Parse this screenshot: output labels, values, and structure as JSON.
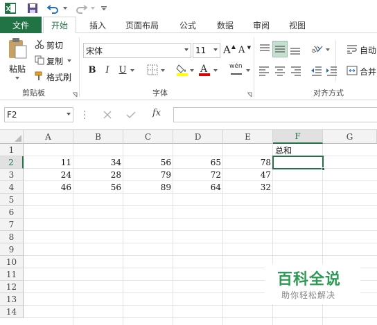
{
  "qat": {
    "icons": [
      "excel-logo-icon",
      "save-icon",
      "undo-icon",
      "redo-icon",
      "customize-icon"
    ]
  },
  "tabs": {
    "file": "文件",
    "items": [
      "开始",
      "插入",
      "页面布局",
      "公式",
      "数据",
      "审阅",
      "视图"
    ],
    "active": "开始"
  },
  "ribbon": {
    "clipboard": {
      "paste": "粘贴",
      "cut": "剪切",
      "copy": "复制",
      "format_painter": "格式刷",
      "group_label": "剪贴板"
    },
    "font": {
      "font_name": "宋体",
      "font_size": "11",
      "bold": "B",
      "italic": "I",
      "underline": "U",
      "increase": "A",
      "decrease": "A",
      "phonetic": "wén",
      "group_label": "字体"
    },
    "alignment": {
      "wrap": "自动",
      "merge": "合并",
      "group_label": "对齐方式"
    }
  },
  "formula_bar": {
    "name_box": "F2",
    "fx": "fx",
    "value": ""
  },
  "grid": {
    "columns": [
      "A",
      "B",
      "C",
      "D",
      "E",
      "F",
      "G"
    ],
    "rows": [
      "1",
      "2",
      "3",
      "4",
      "5",
      "6",
      "7",
      "8",
      "9",
      "10",
      "11",
      "12",
      "13",
      "14"
    ],
    "selected_column": "F",
    "selected_row": "2",
    "header_cell_F1": "总和",
    "data": [
      [
        "11",
        "34",
        "56",
        "65",
        "78"
      ],
      [
        "24",
        "28",
        "79",
        "72",
        "47"
      ],
      [
        "46",
        "56",
        "89",
        "64",
        "32"
      ]
    ]
  },
  "watermark": {
    "title": "百科全说",
    "subtitle": "助你轻松解决"
  },
  "colors": {
    "accent": "#217346",
    "font_highlight": "#ffff00",
    "font_color": "#e00000"
  }
}
